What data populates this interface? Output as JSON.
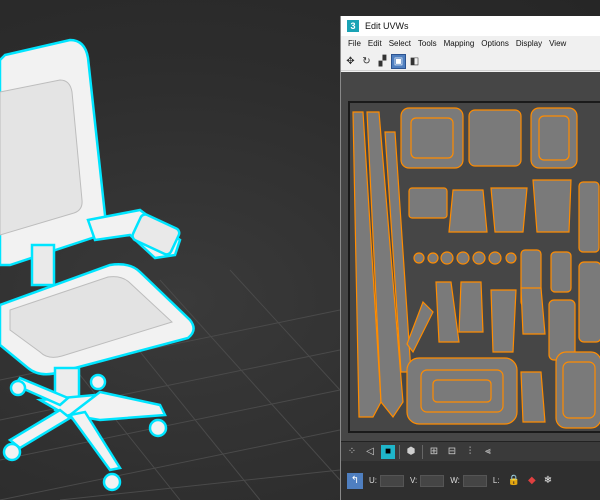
{
  "window": {
    "title": "Edit UVWs",
    "app_icon": "3"
  },
  "menu": [
    "File",
    "Edit",
    "Select",
    "Tools",
    "Mapping",
    "Options",
    "Display",
    "View"
  ],
  "toolbar_icons": [
    "move-icon",
    "rotate-icon",
    "scale-icon",
    "freeform-icon",
    "mirror-icon"
  ],
  "bottom_toolbar_icons": [
    "vertex-icon",
    "edge-icon",
    "face-icon",
    "element-icon",
    "grow-icon",
    "shrink-icon",
    "loop-icon",
    "ring-icon"
  ],
  "status": {
    "u_label": "U:",
    "v_label": "V:",
    "w_label": "W:",
    "l_label": "L:",
    "pick_icon": "pick-icon",
    "lock_icon": "lock-icon",
    "snowflake_icon": "snowflake-icon"
  },
  "colors": {
    "viewport_bg": "#2d2d2d",
    "selection_outline": "#00e5ff",
    "uv_island": "#ff8c00",
    "uv_bg": "#464646"
  }
}
